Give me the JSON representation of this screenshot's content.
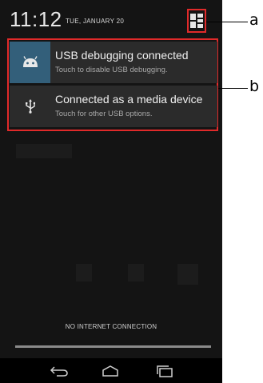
{
  "status": {
    "time": "11:12",
    "date": "TUE, JANUARY 20"
  },
  "notifications": [
    {
      "icon": "android-icon",
      "title": "USB debugging connected",
      "subtitle": "Touch to disable USB debugging."
    },
    {
      "icon": "usb-icon",
      "title": "Connected as a media device",
      "subtitle": "Touch for other USB options."
    }
  ],
  "footer": {
    "connection_status": "NO INTERNET CONNECTION"
  },
  "annotations": {
    "label_a": "a",
    "label_b": "b"
  },
  "colors": {
    "highlight": "#e02a2a",
    "shade_background": "#141414",
    "notification_bg": "#2b2b2b",
    "debug_icon_bg": "#335f7a"
  }
}
